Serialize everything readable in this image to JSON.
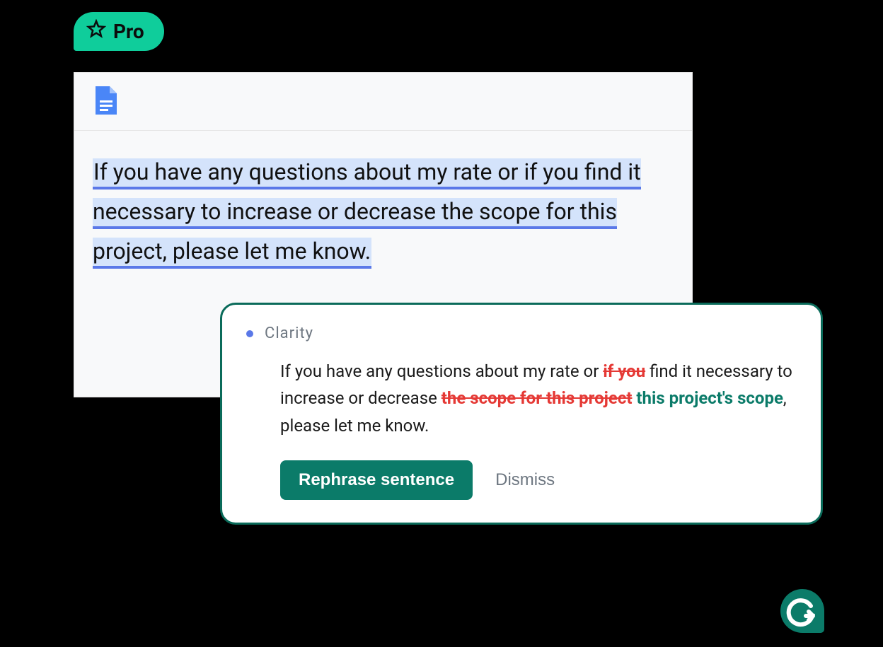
{
  "badge": {
    "label": "Pro"
  },
  "document": {
    "highlighted_text": "If you have any questions about my rate or if you find it necessary to increase or decrease the scope for this project, please let me know."
  },
  "suggestion": {
    "category": "Clarity",
    "segments": {
      "s1": "If you have any questions about my rate or ",
      "strike1": "if you",
      "s2": " find it necessary to increase or decrease ",
      "strike2": "the scope for this project",
      "ins1": " this project's scope",
      "s3": ", please let me know."
    },
    "actions": {
      "primary": "Rephrase sentence",
      "dismiss": "Dismiss"
    }
  }
}
